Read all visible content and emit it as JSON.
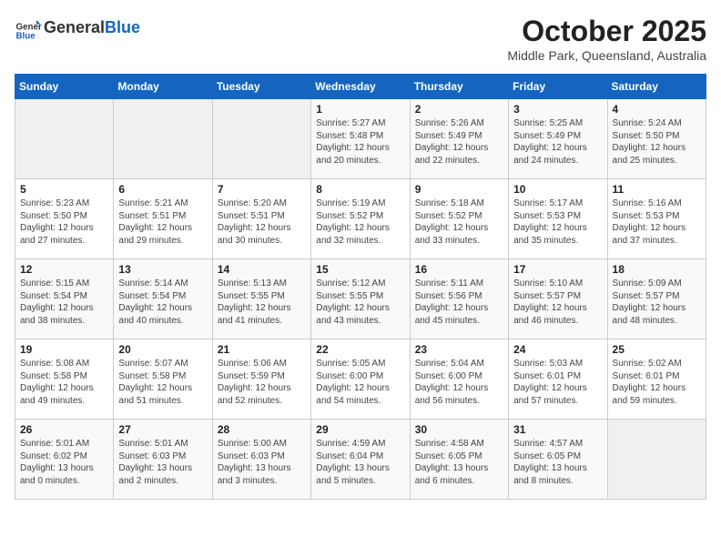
{
  "header": {
    "logo_general": "General",
    "logo_blue": "Blue",
    "month_title": "October 2025",
    "location": "Middle Park, Queensland, Australia"
  },
  "weekdays": [
    "Sunday",
    "Monday",
    "Tuesday",
    "Wednesday",
    "Thursday",
    "Friday",
    "Saturday"
  ],
  "rows": [
    [
      {
        "day": "",
        "info": ""
      },
      {
        "day": "",
        "info": ""
      },
      {
        "day": "",
        "info": ""
      },
      {
        "day": "1",
        "info": "Sunrise: 5:27 AM\nSunset: 5:48 PM\nDaylight: 12 hours and 20 minutes."
      },
      {
        "day": "2",
        "info": "Sunrise: 5:26 AM\nSunset: 5:49 PM\nDaylight: 12 hours and 22 minutes."
      },
      {
        "day": "3",
        "info": "Sunrise: 5:25 AM\nSunset: 5:49 PM\nDaylight: 12 hours and 24 minutes."
      },
      {
        "day": "4",
        "info": "Sunrise: 5:24 AM\nSunset: 5:50 PM\nDaylight: 12 hours and 25 minutes."
      }
    ],
    [
      {
        "day": "5",
        "info": "Sunrise: 5:23 AM\nSunset: 5:50 PM\nDaylight: 12 hours and 27 minutes."
      },
      {
        "day": "6",
        "info": "Sunrise: 5:21 AM\nSunset: 5:51 PM\nDaylight: 12 hours and 29 minutes."
      },
      {
        "day": "7",
        "info": "Sunrise: 5:20 AM\nSunset: 5:51 PM\nDaylight: 12 hours and 30 minutes."
      },
      {
        "day": "8",
        "info": "Sunrise: 5:19 AM\nSunset: 5:52 PM\nDaylight: 12 hours and 32 minutes."
      },
      {
        "day": "9",
        "info": "Sunrise: 5:18 AM\nSunset: 5:52 PM\nDaylight: 12 hours and 33 minutes."
      },
      {
        "day": "10",
        "info": "Sunrise: 5:17 AM\nSunset: 5:53 PM\nDaylight: 12 hours and 35 minutes."
      },
      {
        "day": "11",
        "info": "Sunrise: 5:16 AM\nSunset: 5:53 PM\nDaylight: 12 hours and 37 minutes."
      }
    ],
    [
      {
        "day": "12",
        "info": "Sunrise: 5:15 AM\nSunset: 5:54 PM\nDaylight: 12 hours and 38 minutes."
      },
      {
        "day": "13",
        "info": "Sunrise: 5:14 AM\nSunset: 5:54 PM\nDaylight: 12 hours and 40 minutes."
      },
      {
        "day": "14",
        "info": "Sunrise: 5:13 AM\nSunset: 5:55 PM\nDaylight: 12 hours and 41 minutes."
      },
      {
        "day": "15",
        "info": "Sunrise: 5:12 AM\nSunset: 5:55 PM\nDaylight: 12 hours and 43 minutes."
      },
      {
        "day": "16",
        "info": "Sunrise: 5:11 AM\nSunset: 5:56 PM\nDaylight: 12 hours and 45 minutes."
      },
      {
        "day": "17",
        "info": "Sunrise: 5:10 AM\nSunset: 5:57 PM\nDaylight: 12 hours and 46 minutes."
      },
      {
        "day": "18",
        "info": "Sunrise: 5:09 AM\nSunset: 5:57 PM\nDaylight: 12 hours and 48 minutes."
      }
    ],
    [
      {
        "day": "19",
        "info": "Sunrise: 5:08 AM\nSunset: 5:58 PM\nDaylight: 12 hours and 49 minutes."
      },
      {
        "day": "20",
        "info": "Sunrise: 5:07 AM\nSunset: 5:58 PM\nDaylight: 12 hours and 51 minutes."
      },
      {
        "day": "21",
        "info": "Sunrise: 5:06 AM\nSunset: 5:59 PM\nDaylight: 12 hours and 52 minutes."
      },
      {
        "day": "22",
        "info": "Sunrise: 5:05 AM\nSunset: 6:00 PM\nDaylight: 12 hours and 54 minutes."
      },
      {
        "day": "23",
        "info": "Sunrise: 5:04 AM\nSunset: 6:00 PM\nDaylight: 12 hours and 56 minutes."
      },
      {
        "day": "24",
        "info": "Sunrise: 5:03 AM\nSunset: 6:01 PM\nDaylight: 12 hours and 57 minutes."
      },
      {
        "day": "25",
        "info": "Sunrise: 5:02 AM\nSunset: 6:01 PM\nDaylight: 12 hours and 59 minutes."
      }
    ],
    [
      {
        "day": "26",
        "info": "Sunrise: 5:01 AM\nSunset: 6:02 PM\nDaylight: 13 hours and 0 minutes."
      },
      {
        "day": "27",
        "info": "Sunrise: 5:01 AM\nSunset: 6:03 PM\nDaylight: 13 hours and 2 minutes."
      },
      {
        "day": "28",
        "info": "Sunrise: 5:00 AM\nSunset: 6:03 PM\nDaylight: 13 hours and 3 minutes."
      },
      {
        "day": "29",
        "info": "Sunrise: 4:59 AM\nSunset: 6:04 PM\nDaylight: 13 hours and 5 minutes."
      },
      {
        "day": "30",
        "info": "Sunrise: 4:58 AM\nSunset: 6:05 PM\nDaylight: 13 hours and 6 minutes."
      },
      {
        "day": "31",
        "info": "Sunrise: 4:57 AM\nSunset: 6:05 PM\nDaylight: 13 hours and 8 minutes."
      },
      {
        "day": "",
        "info": ""
      }
    ]
  ]
}
